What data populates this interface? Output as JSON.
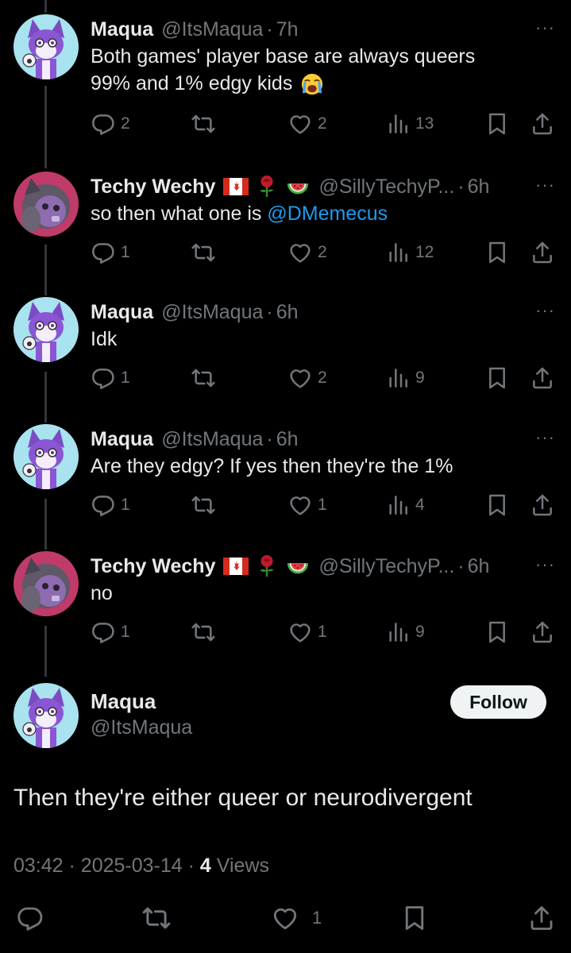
{
  "replies": [
    {
      "name": "Maqua",
      "handle": "@ItsMaqua",
      "time": "7h",
      "text_lines": [
        "Both games' player base are always queers",
        "99% and 1% edgy kids"
      ],
      "replies": "2",
      "reposts": "",
      "likes": "2",
      "views": "13",
      "emoji": "crying-face"
    },
    {
      "name": "Techy Wechy",
      "handle": "@SillyTechyP...",
      "time": "6h",
      "text_prefix": "so then what one is ",
      "mention": "@DMemecus",
      "replies": "1",
      "reposts": "",
      "likes": "2",
      "views": "12",
      "flags": [
        "canada-flag-icon",
        "rose-icon",
        "watermelon-icon"
      ]
    },
    {
      "name": "Maqua",
      "handle": "@ItsMaqua",
      "time": "6h",
      "text": "Idk",
      "replies": "1",
      "reposts": "",
      "likes": "2",
      "views": "9"
    },
    {
      "name": "Maqua",
      "handle": "@ItsMaqua",
      "time": "6h",
      "text": "Are they edgy? If yes then they're the 1%",
      "replies": "1",
      "reposts": "",
      "likes": "1",
      "views": "4"
    },
    {
      "name": "Techy Wechy",
      "handle": "@SillyTechyP...",
      "time": "6h",
      "text": "no",
      "replies": "1",
      "reposts": "",
      "likes": "1",
      "views": "9",
      "flags": [
        "canada-flag-icon",
        "rose-icon",
        "watermelon-icon"
      ]
    }
  ],
  "separator": "·",
  "more": "···",
  "main_tweet": {
    "name": "Maqua",
    "handle": "@ItsMaqua",
    "follow_label": "Follow",
    "text": "Then they're either queer or neurodivergent",
    "time": "03:42",
    "date": "2025-03-14",
    "views_count": "4",
    "views_label": "Views",
    "likes": "1"
  },
  "colors": {
    "background": "#000000",
    "text": "#e7e9ea",
    "muted": "#71767b",
    "link": "#1d9bf0",
    "follow_bg": "#eff3f4"
  }
}
